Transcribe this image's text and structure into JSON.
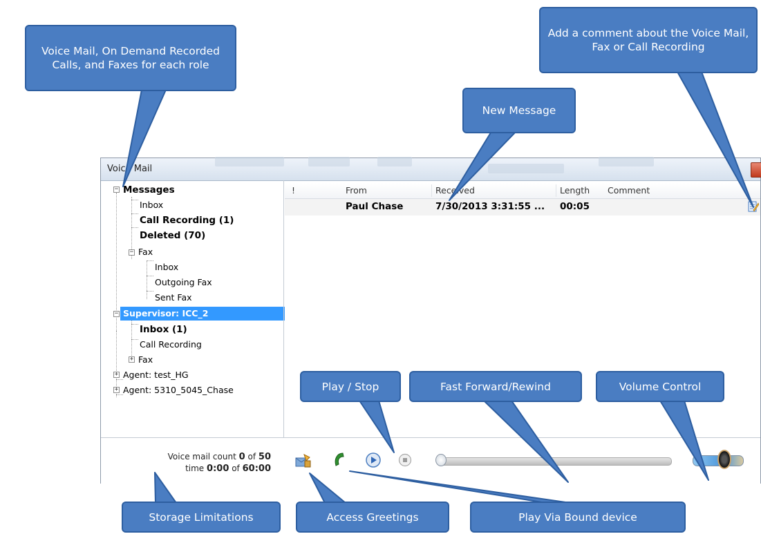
{
  "window": {
    "title": "Voice Mail"
  },
  "tree": {
    "items": [
      {
        "label": "Messages",
        "expander": "−"
      },
      {
        "label": "Inbox"
      },
      {
        "label": "Call Recording (1)"
      },
      {
        "label": "Deleted (70)"
      },
      {
        "label": "Fax",
        "expander": "−"
      },
      {
        "label": "Inbox"
      },
      {
        "label": "Outgoing Fax"
      },
      {
        "label": "Sent Fax"
      },
      {
        "label": "Supervisor: ICC_2",
        "expander": "−",
        "selected": true
      },
      {
        "label": "Inbox (1)"
      },
      {
        "label": "Call Recording"
      },
      {
        "label": "Fax",
        "expander": "+"
      },
      {
        "label": "Agent: test_HG",
        "expander": "+"
      },
      {
        "label": "Agent: 5310_5045_Chase",
        "expander": "+"
      }
    ]
  },
  "list": {
    "columns": [
      "!",
      "From",
      "Received",
      "Length",
      "Comment"
    ],
    "rows": [
      {
        "from": "Paul Chase",
        "received": "7/30/2013 3:31:55 ...",
        "length": "00:05",
        "comment_icon": "edit-note-icon"
      }
    ]
  },
  "storage": {
    "count_label": "Voice mail count",
    "count_value": "0",
    "count_of": "of",
    "count_max": "50",
    "time_label": "time",
    "time_value": "0:00",
    "time_of": "of",
    "time_max": "60:00"
  },
  "controls": {
    "icons": [
      "greetings-icon",
      "phone-icon",
      "play-icon",
      "stop-icon"
    ],
    "seek_position": 0,
    "volume_level": 0.55
  },
  "callouts": {
    "voicemail_roles": "Voice Mail, On Demand Recorded Calls, and Faxes for each role",
    "add_comment": "Add a comment about the Voice Mail, Fax or Call Recording",
    "new_message": "New Message",
    "play_stop": "Play / Stop",
    "fast_forward": "Fast Forward/Rewind",
    "volume": "Volume Control",
    "storage": "Storage Limitations",
    "greetings": "Access Greetings",
    "bound_device": "Play Via Bound device"
  },
  "colors": {
    "callout_fill": "#4a7dc2",
    "selection": "#3399ff"
  }
}
